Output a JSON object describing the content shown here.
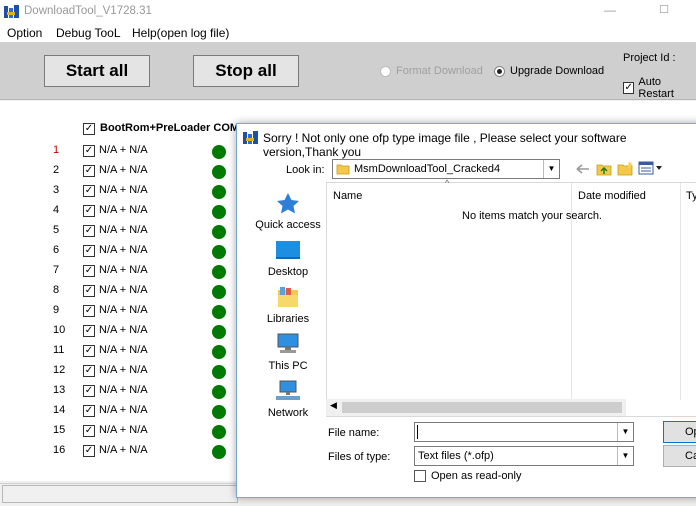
{
  "window": {
    "title": "DownloadTool_V1728.31",
    "minimize": "—",
    "maximize": "☐"
  },
  "menu": [
    "Option",
    "Debug TooL",
    "Help(open log file)"
  ],
  "toolbar": {
    "start_all": "Start all",
    "stop_all": "Stop all",
    "format_download": "Format Download",
    "upgrade_download": "Upgrade Download",
    "upgrade_selected": true,
    "project_id_label": "Project Id :",
    "auto_restart": "Auto Restart",
    "auto_restart_checked": true
  },
  "list": {
    "header": "BootRom+PreLoader COM",
    "rows": [
      {
        "num": "1",
        "label": "N/A + N/A",
        "highlight": true
      },
      {
        "num": "2",
        "label": "N/A + N/A"
      },
      {
        "num": "3",
        "label": "N/A + N/A"
      },
      {
        "num": "4",
        "label": "N/A + N/A"
      },
      {
        "num": "5",
        "label": "N/A + N/A"
      },
      {
        "num": "6",
        "label": "N/A + N/A"
      },
      {
        "num": "7",
        "label": "N/A + N/A"
      },
      {
        "num": "8",
        "label": "N/A + N/A"
      },
      {
        "num": "9",
        "label": "N/A + N/A"
      },
      {
        "num": "10",
        "label": "N/A + N/A"
      },
      {
        "num": "11",
        "label": "N/A + N/A"
      },
      {
        "num": "12",
        "label": "N/A + N/A"
      },
      {
        "num": "13",
        "label": "N/A + N/A"
      },
      {
        "num": "14",
        "label": "N/A + N/A"
      },
      {
        "num": "15",
        "label": "N/A + N/A"
      },
      {
        "num": "16",
        "label": "N/A + N/A"
      }
    ]
  },
  "dialog": {
    "title": "Sorry ! Not only one ofp type image file , Please select your software version,Thank you",
    "look_in_label": "Look in:",
    "look_in_value": "MsmDownloadTool_Cracked4",
    "places": [
      "Quick access",
      "Desktop",
      "Libraries",
      "This PC",
      "Network"
    ],
    "columns": [
      "Name",
      "Date modified",
      "Ty"
    ],
    "empty_message": "No items match your search.",
    "file_name_label": "File name:",
    "file_name_value": "",
    "files_of_type_label": "Files of type:",
    "files_of_type_value": "Text files (*.ofp)",
    "read_only_label": "Open as read-only",
    "open_button": "Op",
    "cancel_button": "Can"
  },
  "colors": {
    "status_ok": "#007a00",
    "toolbar_bg": "#cfcfcf",
    "row_highlight": "#c00000"
  }
}
